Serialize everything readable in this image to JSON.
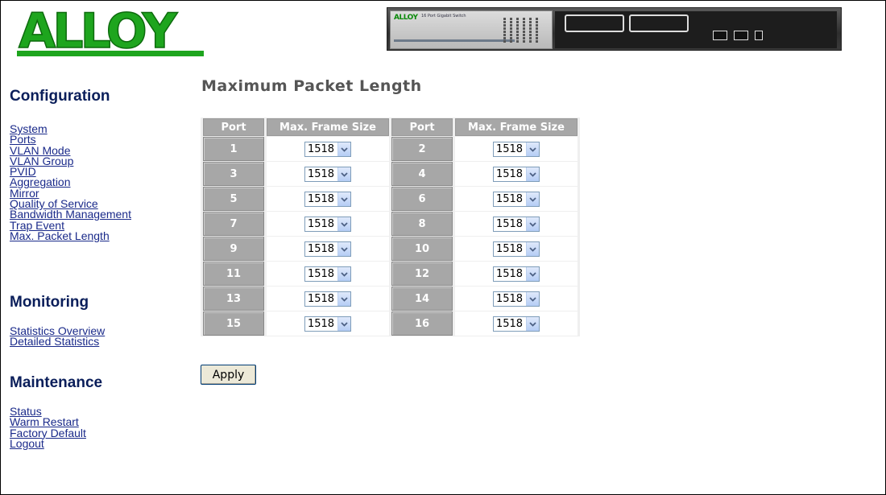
{
  "header": {
    "logo_text": "ALLOY",
    "device_brand": "ALLOY",
    "device_model": "16 Port Gigabit Switch"
  },
  "sidebar": {
    "sections": [
      {
        "title": "Configuration",
        "links": [
          "System",
          "Ports",
          "VLAN Mode",
          "VLAN Group",
          "PVID",
          "Aggregation",
          "Mirror",
          "Quality of Service",
          "Bandwidth Management",
          "Trap Event",
          "Max. Packet Length"
        ]
      },
      {
        "title": "Monitoring",
        "links": [
          "Statistics Overview",
          "Detailed Statistics"
        ]
      },
      {
        "title": "Maintenance",
        "links": [
          "Status",
          "Warm Restart",
          "Factory Default",
          "Logout"
        ]
      }
    ]
  },
  "main": {
    "title": "Maximum Packet Length",
    "columns": [
      "Port",
      "Max. Frame Size",
      "Port",
      "Max. Frame Size"
    ],
    "rows": [
      {
        "port_a": "1",
        "size_a": "1518",
        "port_b": "2",
        "size_b": "1518"
      },
      {
        "port_a": "3",
        "size_a": "1518",
        "port_b": "4",
        "size_b": "1518"
      },
      {
        "port_a": "5",
        "size_a": "1518",
        "port_b": "6",
        "size_b": "1518"
      },
      {
        "port_a": "7",
        "size_a": "1518",
        "port_b": "8",
        "size_b": "1518"
      },
      {
        "port_a": "9",
        "size_a": "1518",
        "port_b": "10",
        "size_b": "1518"
      },
      {
        "port_a": "11",
        "size_a": "1518",
        "port_b": "12",
        "size_b": "1518"
      },
      {
        "port_a": "13",
        "size_a": "1518",
        "port_b": "14",
        "size_b": "1518"
      },
      {
        "port_a": "15",
        "size_a": "1518",
        "port_b": "16",
        "size_b": "1518"
      }
    ],
    "apply_label": "Apply"
  },
  "colors": {
    "logo_green": "#1ea51e",
    "header_cell": "#a7a7a7",
    "section_title": "#0a1e5a",
    "link": "#1a2a8a"
  },
  "icons": {
    "dropdown": "chevron-down-icon"
  }
}
